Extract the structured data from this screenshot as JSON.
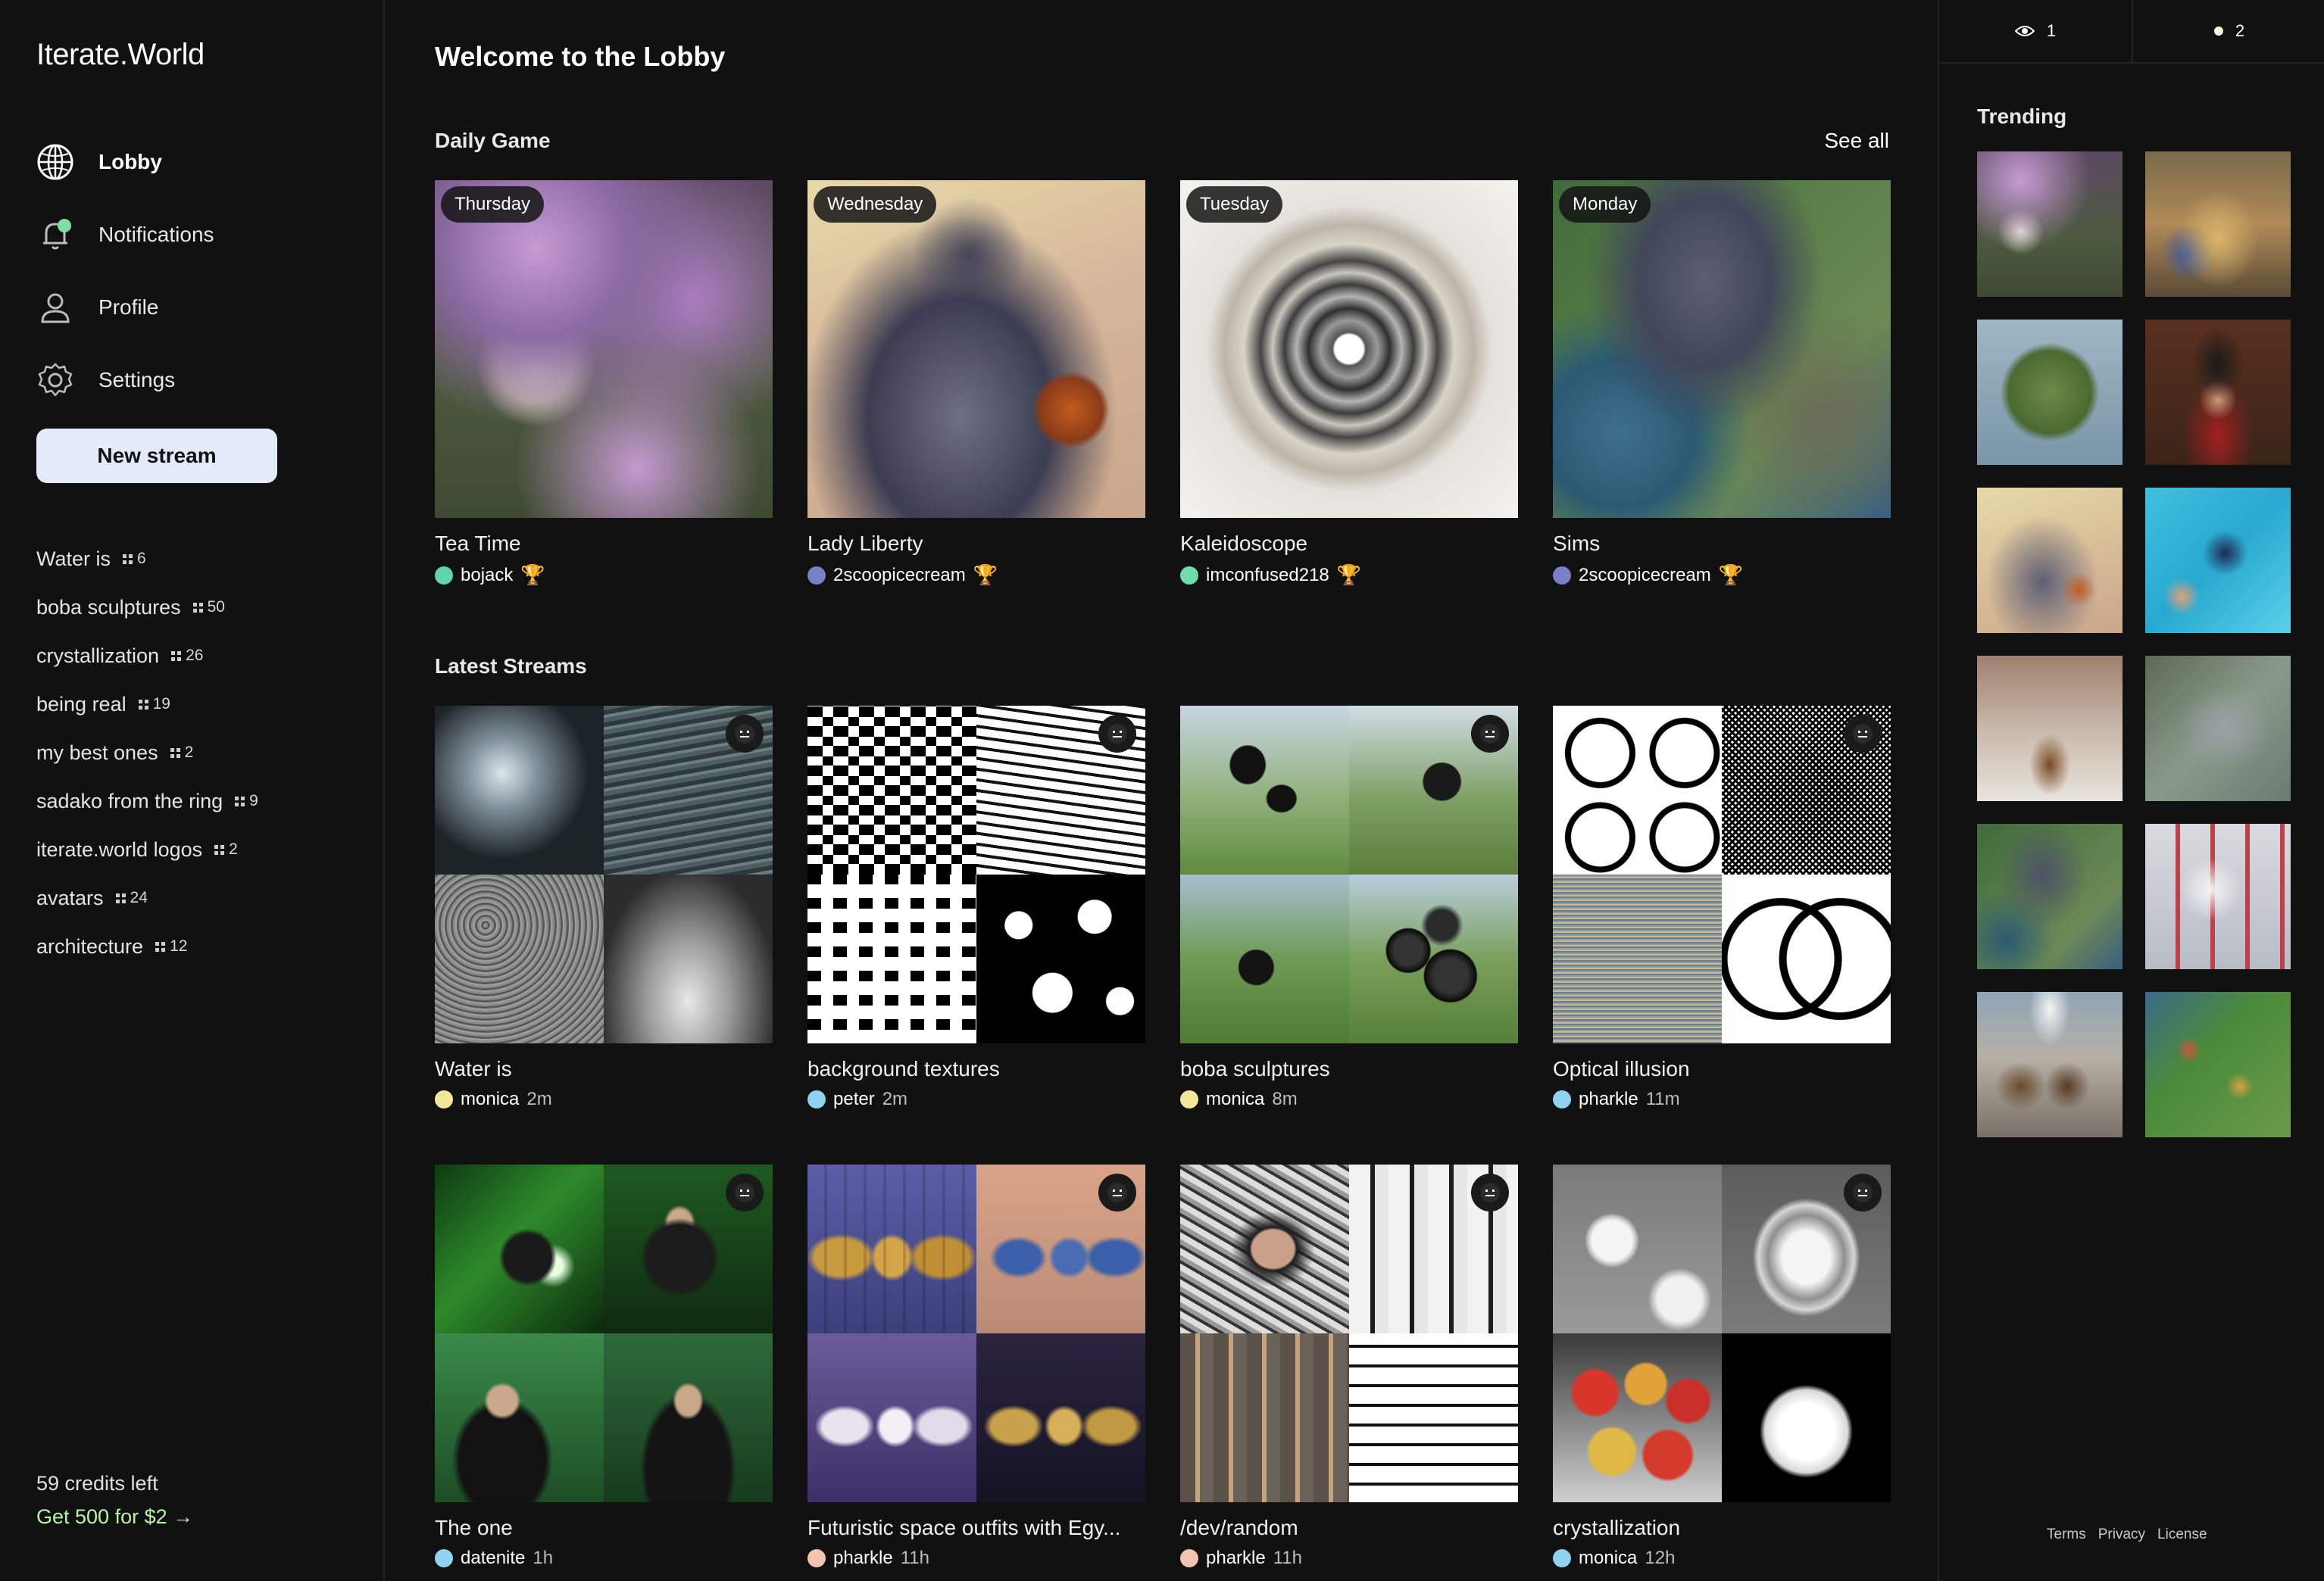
{
  "app": {
    "logo": "Iterate.World"
  },
  "sidebar": {
    "nav": [
      {
        "label": "Lobby",
        "icon": "globe-icon",
        "active": true
      },
      {
        "label": "Notifications",
        "icon": "bell-icon"
      },
      {
        "label": "Profile",
        "icon": "person-icon"
      },
      {
        "label": "Settings",
        "icon": "gear-icon"
      }
    ],
    "new_stream_label": "New stream",
    "collections": [
      {
        "name": "Water is",
        "count": "6"
      },
      {
        "name": "boba sculptures",
        "count": "50"
      },
      {
        "name": "crystallization",
        "count": "26"
      },
      {
        "name": "being real",
        "count": "19"
      },
      {
        "name": "my best ones",
        "count": "2"
      },
      {
        "name": "sadako from the ring",
        "count": "9"
      },
      {
        "name": "iterate.world logos",
        "count": "2"
      },
      {
        "name": "avatars",
        "count": "24"
      },
      {
        "name": "architecture",
        "count": "12"
      }
    ],
    "credits": "59 credits left",
    "get_more": "Get 500 for $2"
  },
  "main": {
    "title": "Welcome to the Lobby",
    "daily": {
      "title": "Daily Game",
      "see_all": "See all",
      "cards": [
        {
          "day": "Thursday",
          "title": "Tea Time",
          "user": "bojack",
          "avatar_color": "#5fd6a8"
        },
        {
          "day": "Wednesday",
          "title": "Lady Liberty",
          "user": "2scoopicecream",
          "avatar_color": "#7a7fc9"
        },
        {
          "day": "Tuesday",
          "title": "Kaleidoscope",
          "user": "imconfused218",
          "avatar_color": "#6fdcae"
        },
        {
          "day": "Monday",
          "title": "Sims",
          "user": "2scoopicecream",
          "avatar_color": "#7a7fc9"
        }
      ]
    },
    "latest": {
      "title": "Latest Streams",
      "cards": [
        {
          "title": "Water is",
          "user": "monica",
          "time": "2m",
          "avatar_color": "#f3e89a"
        },
        {
          "title": "background textures",
          "user": "peter",
          "time": "2m",
          "avatar_color": "#8fd3f0"
        },
        {
          "title": "boba sculptures",
          "user": "monica",
          "time": "8m",
          "avatar_color": "#f3e89a"
        },
        {
          "title": "Optical illusion",
          "user": "pharkle",
          "time": "11m",
          "avatar_color": "#8fd3f0"
        },
        {
          "title": "The one",
          "user": "datenite",
          "time": "1h",
          "avatar_color": "#8fd3f0"
        },
        {
          "title": "Futuristic space outfits with Egy...",
          "user": "pharkle",
          "time": "11h",
          "avatar_color": "#f2c3b0"
        },
        {
          "title": "/dev/random",
          "user": "pharkle",
          "time": "11h",
          "avatar_color": "#f2c3b0"
        },
        {
          "title": "crystallization",
          "user": "monica",
          "time": "12h",
          "avatar_color": "#8fd3f0"
        }
      ]
    }
  },
  "right": {
    "viewers": "1",
    "online": "2",
    "trending_title": "Trending",
    "footer": {
      "terms": "Terms",
      "privacy": "Privacy",
      "license": "License"
    }
  },
  "colors": {
    "background": "#111111",
    "accent_button": "#e3ebfa",
    "credit_link": "#b8f5a8",
    "notification_dot": "#7ee0a0"
  }
}
